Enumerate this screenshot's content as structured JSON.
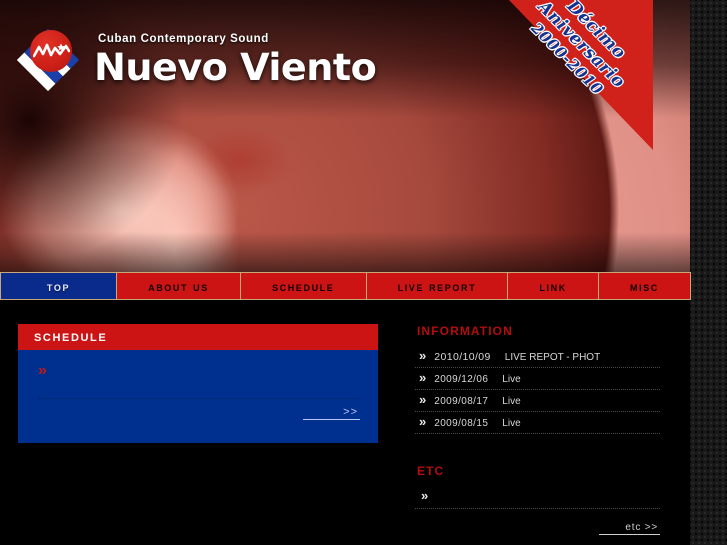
{
  "site": {
    "tagline": "Cuban Contemporary Sound",
    "wordmark": "Nuevo Viento"
  },
  "ribbon": {
    "line1": "Décimo",
    "line2": "Aniversario",
    "line3": "2000-2010",
    "bg_color": "#d0211a",
    "text_color": "#16328f"
  },
  "nav": {
    "items": [
      {
        "label": "Top",
        "active": true
      },
      {
        "label": "About Us",
        "active": false
      },
      {
        "label": "Schedule",
        "active": false
      },
      {
        "label": "Live Report",
        "active": false
      },
      {
        "label": "Link",
        "active": false
      },
      {
        "label": "Misc",
        "active": false
      }
    ],
    "active_color": "#0b2b8c",
    "inactive_color": "#cc1414"
  },
  "schedule": {
    "title": "Schedule",
    "header_color": "#cc1414",
    "body_color": "#00308f",
    "entry_marker": "»",
    "entry_text": "",
    "more_label": ">>"
  },
  "information": {
    "title": "Information",
    "title_color": "#b40d0d",
    "marker": "»",
    "items": [
      {
        "date": "2010/10/09",
        "label": "LIVE REPOT - PHOT"
      },
      {
        "date": "2009/12/06",
        "label": "Live"
      },
      {
        "date": "2009/08/17",
        "label": "Live"
      },
      {
        "date": "2009/08/15",
        "label": "Live"
      }
    ]
  },
  "etc": {
    "title": "Etc",
    "marker": "»",
    "entry_text": "",
    "more_label": "etc >>"
  }
}
